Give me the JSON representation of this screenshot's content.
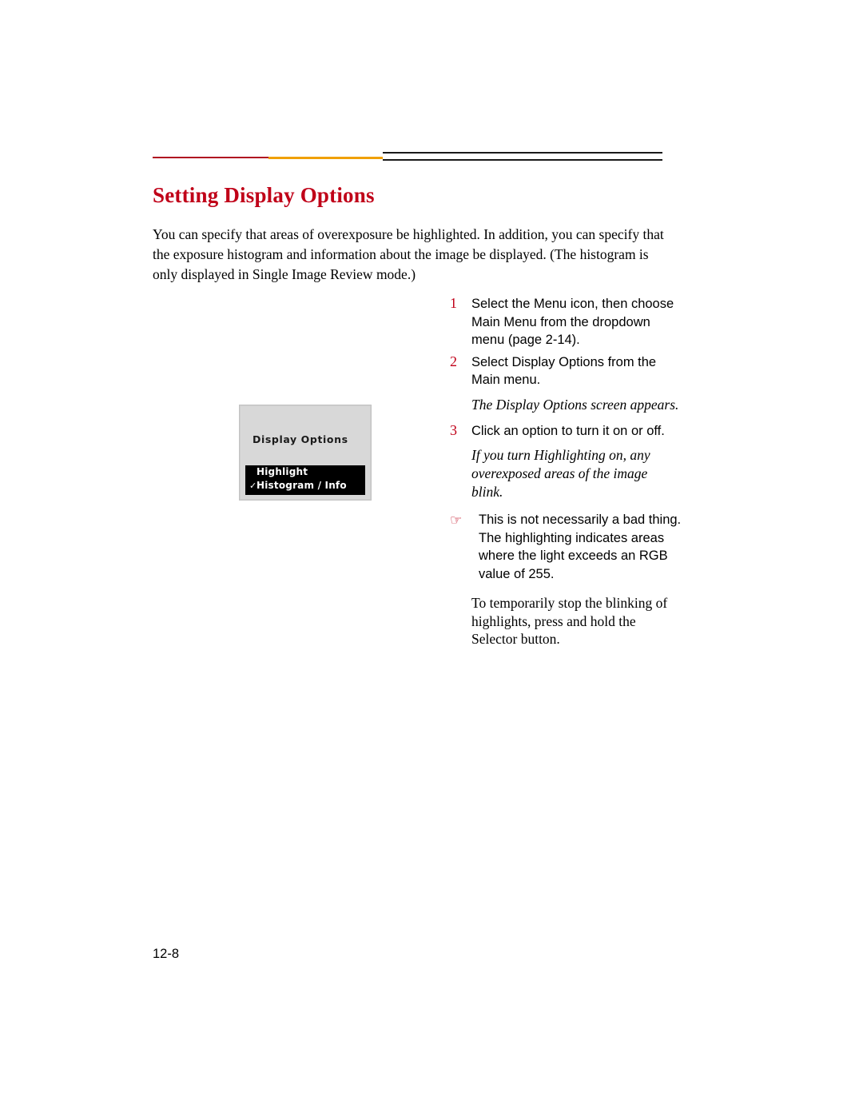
{
  "page": {
    "title": "Setting Display Options",
    "folio": "12-8",
    "intro": "You can specify that areas of overexposure be highlighted. In addition, you can specify that the exposure histogram and information about the image be displayed. (The histogram is only displayed in Single Image Review mode.)"
  },
  "rules": {
    "accent_red": "#c00018",
    "accent_orange": "#f0a000",
    "accent_black": "#1a1a1a"
  },
  "steps": [
    {
      "num": "1",
      "text": "Select the Menu icon, then choose Main Menu from the dropdown menu (page 2-14)."
    },
    {
      "num": "2",
      "text": "Select Display Options from the Main menu."
    },
    {
      "num": "3",
      "text": "Click an option to turn it on or off."
    }
  ],
  "notes": {
    "after_step2": "The Display Options screen appears.",
    "after_step3": "If you turn Highlighting on, any overexposed areas of the image blink."
  },
  "tip": {
    "pointer_icon": "pointing-hand-icon",
    "text": "This is not necessarily a bad thing. The highlighting indicates areas where the light exceeds an RGB value of 255."
  },
  "closing": "To temporarily stop the blinking of highlights, press and hold the Selector button.",
  "figure": {
    "name": "display-options-lcd-screen",
    "screen_title": "Display Options",
    "items": [
      {
        "label": "Highlight",
        "checked": false,
        "check_glyph": ""
      },
      {
        "label": "Histogram / Info",
        "checked": true,
        "check_glyph": "✓"
      }
    ]
  }
}
